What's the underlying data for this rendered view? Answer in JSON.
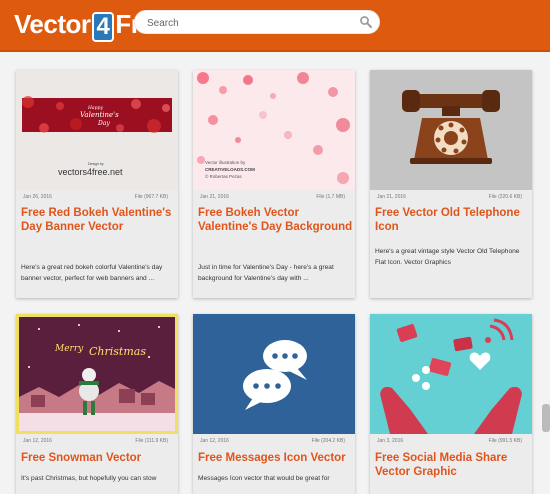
{
  "header": {
    "logo": {
      "prefix": "Vector",
      "four": "4",
      "suffix": "Free"
    },
    "search_placeholder": "Search",
    "colors": {
      "bar": "#dd5a0e",
      "logo_badge": "#2a78b8"
    }
  },
  "cards": [
    {
      "image_text": {
        "line1": "Happy",
        "line2": "Valentine's",
        "line3": "Day",
        "credit_small": "Design by",
        "credit": "vectors4free.net"
      },
      "date": "Jan 26, 2016",
      "file": "File (967.7 KB)",
      "title": "Free Red Bokeh Valentine's Day Banner Vector",
      "desc": "Here's a great red bokeh colorful Valentine's day banner vector, perfect for web banners and ..."
    },
    {
      "image_text": {
        "line1": "Vector illustration by",
        "line2": "CREATIVELOADS.COM",
        "line3": "© Robertas Pezas"
      },
      "date": "Jan 21, 2016",
      "file": "File (1.7 MB)",
      "title": "Free Bokeh Vector Valentine's Day Background",
      "desc": "Just in time for Valentine's Day - here's a great background for Valentine's day with ..."
    },
    {
      "date": "Jan 21, 2016",
      "file": "File (220.6 KB)",
      "title": "Free Vector Old Telephone Icon",
      "desc": "Here's a great vintage style Vector Old Telephone Flat Icon. Vector Graphics"
    },
    {
      "image_text": {
        "line1": "Merry",
        "line2": "Christmas"
      },
      "date": "Jan 12, 2016",
      "file": "File (111.9 KB)",
      "title": "Free Snowman Vector",
      "desc": "It's past Christmas, but hopefully you can stow"
    },
    {
      "date": "Jan 12, 2016",
      "file": "File (204.2 KB)",
      "title": "Free Messages Icon Vector",
      "desc": "Messages Icon vector that would be great for"
    },
    {
      "date": "Jan 3, 2016",
      "file": "File (991.5 KB)",
      "title": "Free Social Media Share Vector Graphic",
      "desc": ""
    }
  ]
}
